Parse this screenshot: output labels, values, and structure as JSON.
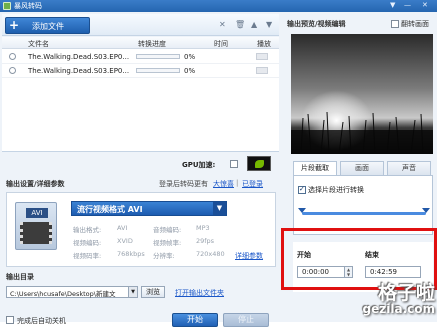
{
  "window": {
    "title": "暴风转码",
    "controls": [
      "▼",
      "—",
      "✕"
    ]
  },
  "toolbar": {
    "add_file_label": "添加文件",
    "add_icon": "plus-icon"
  },
  "file_list": {
    "columns": [
      "文件名",
      "转换进度",
      "时间",
      "播放"
    ],
    "rows": [
      {
        "name": "The.Walking.Dead.S03.EP0...",
        "progress": "0%",
        "progress_value": 0
      },
      {
        "name": "The.Walking.Dead.S03.EP0...",
        "progress": "0%",
        "progress_value": 0
      }
    ]
  },
  "gpu": {
    "label": "GPU加速:",
    "checked": false
  },
  "output_settings": {
    "title": "输出设置/详细参数",
    "login_text": "登录后转码更有",
    "link_fun": "大惊喜",
    "link_login": "已登录",
    "separator": "|"
  },
  "format": {
    "icon_tag": "AVI",
    "selected": "流行视频格式  AVI",
    "params": [
      {
        "k": "输出格式:",
        "v": "AVI"
      },
      {
        "k": "音频编码:",
        "v": "MP3"
      },
      {
        "k": "视频编码:",
        "v": "XVID"
      },
      {
        "k": "视频帧率:",
        "v": "29fps"
      },
      {
        "k": "视频码率:",
        "v": "768kbps"
      },
      {
        "k": "分辨率:",
        "v": "720x480"
      }
    ],
    "detail_link": "详细参数"
  },
  "output_dir": {
    "label": "输出目录",
    "path": "C:\\Users\\hcusafe\\Desktop\\新建文",
    "browse": "浏览",
    "open_folder": "打开输出文件夹"
  },
  "bottom": {
    "shutdown_label": "完成后自动关机",
    "start": "开始",
    "stop": "停止"
  },
  "preview": {
    "title": "输出预览/视频编辑",
    "flip_label": "翻转画面",
    "tabs": [
      "片段截取",
      "画面",
      "声音"
    ],
    "segment_label": "选择片段进行转换",
    "segment_checked": true,
    "start_label": "开始",
    "end_label": "结束",
    "start_time": "0:00:00",
    "end_time": "0:42:59"
  },
  "watermark": {
    "cn": "格子啦",
    "en": "gezila.com"
  },
  "colors": {
    "titlebar": "#2566b0",
    "accent": "#1d5bb0",
    "highlight_box": "#e01010",
    "link": "#1a56c8"
  }
}
